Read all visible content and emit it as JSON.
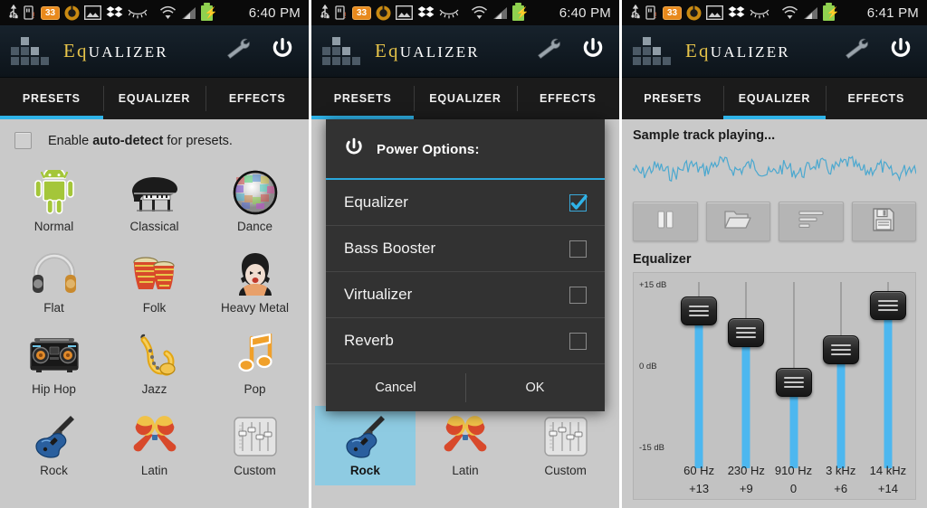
{
  "app": {
    "name_prefix": "Eq",
    "name_suffix": "UALIZER",
    "wrench_icon": "wrench-icon",
    "power_icon": "power-icon",
    "logo_icon": "equalizer-bars-logo-icon"
  },
  "statusbar": {
    "icons": [
      "usb-icon",
      "sd-card-warning-icon",
      "battery-percent-badge-icon",
      "antivirus-icon",
      "gallery-icon",
      "sleep-eyelash-icon",
      "wifi-icon",
      "signal-icon",
      "battery-charging-icon"
    ],
    "battery_badge": "33",
    "time_panel1": "6:40 PM",
    "time_panel2": "6:40 PM",
    "time_panel3": "6:41 PM"
  },
  "tabs": {
    "presets": "PRESETS",
    "equalizer": "EQUALIZER",
    "effects": "EFFECTS",
    "active_panel1": "PRESETS",
    "active_panel2": "PRESETS",
    "active_panel3": "EQUALIZER",
    "accent_color": "#2fb3e8"
  },
  "presets_screen": {
    "autodetect_label_pre": "Enable ",
    "autodetect_label_bold": "auto-detect",
    "autodetect_label_post": " for presets.",
    "autodetect_checked": false,
    "items": [
      {
        "name": "Normal",
        "icon": "android-robot-icon"
      },
      {
        "name": "Classical",
        "icon": "grand-piano-icon"
      },
      {
        "name": "Dance",
        "icon": "disco-ball-icon"
      },
      {
        "name": "Flat",
        "icon": "headphones-icon"
      },
      {
        "name": "Folk",
        "icon": "bongo-drums-icon"
      },
      {
        "name": "Heavy Metal",
        "icon": "rocker-head-icon"
      },
      {
        "name": "Hip Hop",
        "icon": "boombox-icon"
      },
      {
        "name": "Jazz",
        "icon": "saxophone-icon"
      },
      {
        "name": "Pop",
        "icon": "music-notes-icon"
      },
      {
        "name": "Rock",
        "icon": "electric-guitar-icon"
      },
      {
        "name": "Latin",
        "icon": "maracas-icon"
      },
      {
        "name": "Custom",
        "icon": "sliders-icon"
      }
    ],
    "selected_panel2": "Rock",
    "selection_color": "#8ecbe2"
  },
  "dialog": {
    "title": "Power Options:",
    "icon": "power-icon",
    "rule_color": "#2aa8dd",
    "options": [
      {
        "label": "Equalizer",
        "checked": true
      },
      {
        "label": "Bass Booster",
        "checked": false
      },
      {
        "label": "Virtualizer",
        "checked": false
      },
      {
        "label": "Reverb",
        "checked": false
      }
    ],
    "cancel_label": "Cancel",
    "ok_label": "OK"
  },
  "equalizer_screen": {
    "sample_title": "Sample track playing...",
    "waveform_color": "#4ba8cf",
    "transport": [
      {
        "name": "pause-button",
        "icon": "pause-icon"
      },
      {
        "name": "open-button",
        "icon": "folder-open-icon"
      },
      {
        "name": "list-button",
        "icon": "list-lines-icon"
      },
      {
        "name": "save-button",
        "icon": "floppy-save-icon"
      }
    ],
    "section_label": "Equalizer",
    "scale_top": "+15 dB",
    "scale_mid": "0 dB",
    "scale_bottom": "-15 dB",
    "slider_color": "#4db7ef",
    "bands": [
      {
        "freq": "60 Hz",
        "value": "+13",
        "db": 13
      },
      {
        "freq": "230 Hz",
        "value": "+9",
        "db": 9
      },
      {
        "freq": "910 Hz",
        "value": "0",
        "db": 0
      },
      {
        "freq": "3 kHz",
        "value": "+6",
        "db": 6
      },
      {
        "freq": "14 kHz",
        "value": "+14",
        "db": 14
      }
    ],
    "db_min": -15,
    "db_max": 15
  }
}
